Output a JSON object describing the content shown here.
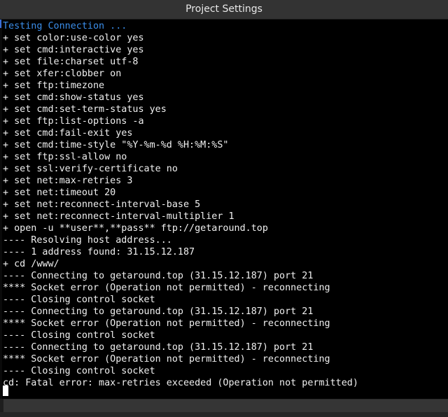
{
  "window": {
    "title": "Project Settings"
  },
  "terminal": {
    "lines": [
      "Testing Connection ...",
      "+ set color:use-color yes",
      "+ set cmd:interactive yes",
      "+ set file:charset utf-8",
      "+ set xfer:clobber on",
      "+ set ftp:timezone",
      "+ set cmd:show-status yes",
      "+ set cmd:set-term-status yes",
      "+ set ftp:list-options -a",
      "+ set cmd:fail-exit yes",
      "+ set cmd:time-style \"%Y-%m-%d %H:%M:%S\"",
      "+ set ftp:ssl-allow no",
      "+ set ssl:verify-certificate no",
      "+ set net:max-retries 3",
      "+ set net:timeout 20",
      "+ set net:reconnect-interval-base 5",
      "+ set net:reconnect-interval-multiplier 1",
      "+ open -u **user**,**pass** ftp://getaround.top",
      "---- Resolving host address...",
      "---- 1 address found: 31.15.12.187",
      "+ cd /www/",
      "---- Connecting to getaround.top (31.15.12.187) port 21",
      "**** Socket error (Operation not permitted) - reconnecting",
      "---- Closing control socket",
      "---- Connecting to getaround.top (31.15.12.187) port 21",
      "**** Socket error (Operation not permitted) - reconnecting",
      "---- Closing control socket",
      "---- Connecting to getaround.top (31.15.12.187) port 21",
      "**** Socket error (Operation not permitted) - reconnecting",
      "---- Closing control socket",
      "cd: Fatal error: max-retries exceeded (Operation not permitted)"
    ],
    "colors": {
      "background": "#000000",
      "text": "#f0f0f0",
      "heading": "#3b8eea",
      "cursor": "#ffffff"
    }
  }
}
